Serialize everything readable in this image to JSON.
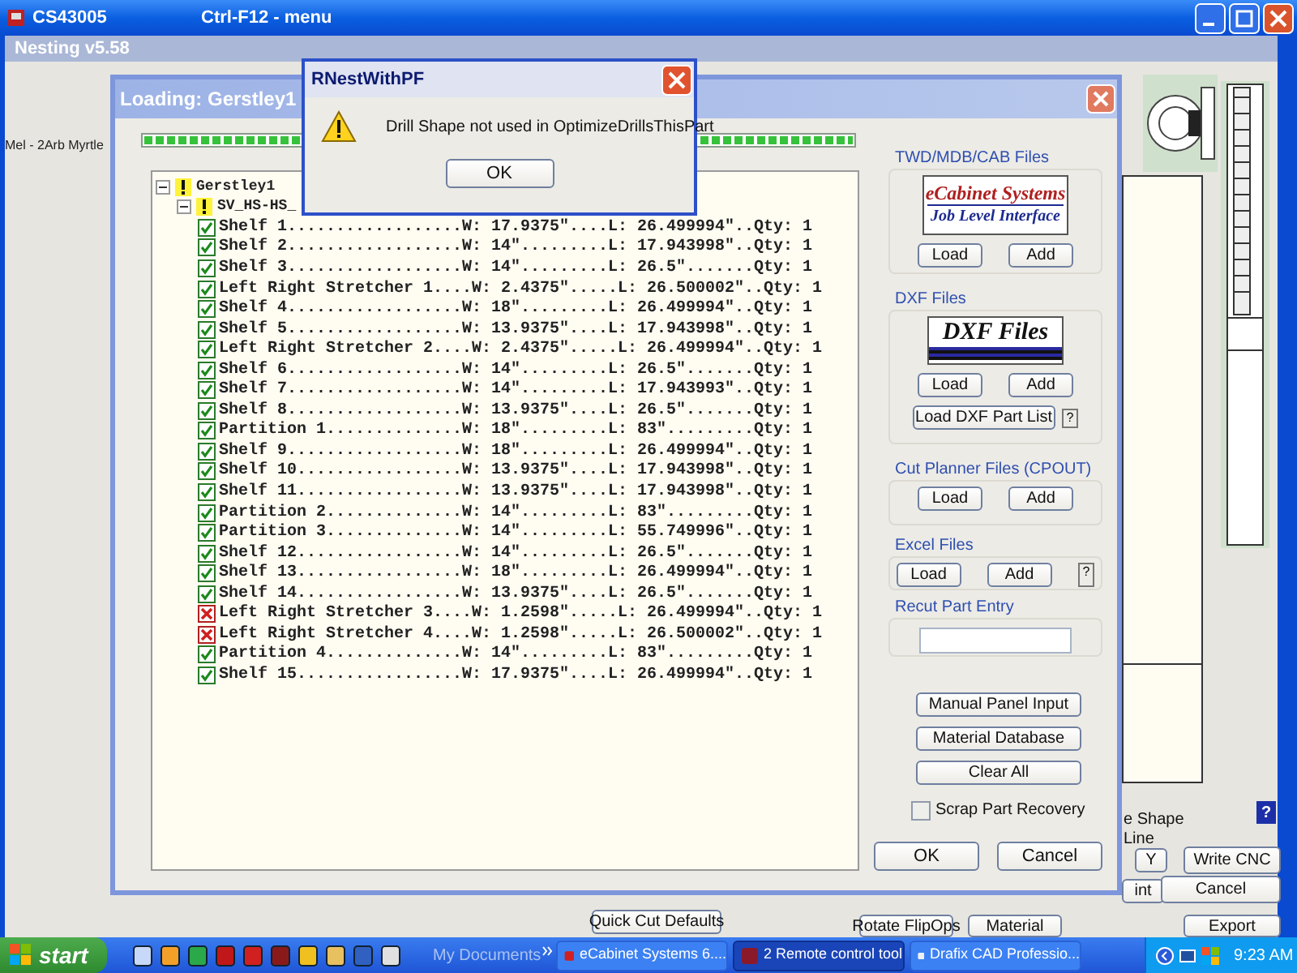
{
  "window": {
    "title": "CS43005",
    "menu_hint": "Ctrl-F12 - menu"
  },
  "app": {
    "title": "Nesting v5.58",
    "material_label": "Mel - 2Arb Myrtle",
    "side_labels": [
      "e Shape",
      "Line"
    ],
    "help": "?",
    "buttons": [
      {
        "label": "Y"
      },
      {
        "label": "Write CNC"
      },
      {
        "label": "int"
      },
      {
        "label": "Cancel"
      },
      {
        "label": "Quick Cut Defaults"
      },
      {
        "label": "Rotate FlipOps"
      },
      {
        "label": "Material"
      },
      {
        "label": "Export"
      }
    ]
  },
  "loading_dialog": {
    "title": "Loading: Gerstley1",
    "progress": {
      "level": 1
    },
    "tree": {
      "kind": "job",
      "label": "Gerstley1",
      "expanded": true,
      "children": [
        {
          "kind": "job",
          "label": "SV_HS-HS_",
          "expanded": true,
          "children": [
            {
              "kind": "part",
              "label": "Shelf 1..................W: 17.9375\"....L: 26.499994\"..Qty: 1",
              "checked": true
            },
            {
              "kind": "part",
              "label": "Shelf 2..................W: 14\".........L: 17.943998\"..Qty: 1",
              "checked": true
            },
            {
              "kind": "part",
              "label": "Shelf 3..................W: 14\".........L: 26.5\".......Qty: 1",
              "checked": true
            },
            {
              "kind": "part",
              "label": "Left Right Stretcher 1....W: 2.4375\".....L: 26.500002\"..Qty: 1",
              "checked": true
            },
            {
              "kind": "part",
              "label": "Shelf 4..................W: 18\".........L: 26.499994\"..Qty: 1",
              "checked": true
            },
            {
              "kind": "part",
              "label": "Shelf 5..................W: 13.9375\"....L: 17.943998\"..Qty: 1",
              "checked": true
            },
            {
              "kind": "part",
              "label": "Left Right Stretcher 2....W: 2.4375\".....L: 26.499994\"..Qty: 1",
              "checked": true
            },
            {
              "kind": "part",
              "label": "Shelf 6..................W: 14\".........L: 26.5\".......Qty: 1",
              "checked": true
            },
            {
              "kind": "part",
              "label": "Shelf 7..................W: 14\".........L: 17.943993\"..Qty: 1",
              "checked": true
            },
            {
              "kind": "part",
              "label": "Shelf 8..................W: 13.9375\"....L: 26.5\".......Qty: 1",
              "checked": true
            },
            {
              "kind": "part",
              "label": "Partition 1..............W: 18\".........L: 83\".........Qty: 1",
              "checked": true
            },
            {
              "kind": "part",
              "label": "Shelf 9..................W: 18\".........L: 26.499994\"..Qty: 1",
              "checked": true
            },
            {
              "kind": "part",
              "label": "Shelf 10.................W: 13.9375\"....L: 17.943998\"..Qty: 1",
              "checked": true
            },
            {
              "kind": "part",
              "label": "Shelf 11.................W: 13.9375\"....L: 17.943998\"..Qty: 1",
              "checked": true
            },
            {
              "kind": "part",
              "label": "Partition 2..............W: 14\".........L: 83\".........Qty: 1",
              "checked": true
            },
            {
              "kind": "part",
              "label": "Partition 3..............W: 14\".........L: 55.749996\"..Qty: 1",
              "checked": true
            },
            {
              "kind": "part",
              "label": "Shelf 12.................W: 14\".........L: 26.5\".......Qty: 1",
              "checked": true
            },
            {
              "kind": "part",
              "label": "Shelf 13.................W: 18\".........L: 26.499994\"..Qty: 1",
              "checked": true
            },
            {
              "kind": "part",
              "label": "Shelf 14.................W: 13.9375\"....L: 26.5\".......Qty: 1",
              "checked": true
            },
            {
              "kind": "part",
              "label": "Left Right Stretcher 3....W: 1.2598\".....L: 26.499994\"..Qty: 1",
              "checked": false
            },
            {
              "kind": "part",
              "label": "Left Right Stretcher 4....W: 1.2598\".....L: 26.500002\"..Qty: 1",
              "checked": false
            },
            {
              "kind": "part",
              "label": "Partition 4..............W: 14\".........L: 83\".........Qty: 1",
              "checked": true
            },
            {
              "kind": "part",
              "label": "Shelf 15.................W: 17.9375\"....L: 26.499994\"..Qty: 1",
              "checked": true
            }
          ]
        }
      ]
    },
    "groups": [
      {
        "kind": "files",
        "title": "TWD/MDB/CAB Files",
        "logo": {
          "kind": "ecabinet",
          "lines": [
            "eCabinet Systems",
            "Job Level Interface"
          ]
        },
        "buttons": [
          "Load",
          "Add"
        ]
      },
      {
        "kind": "files",
        "title": "DXF Files",
        "logo": {
          "kind": "dxf",
          "lines": [
            "DXF Files"
          ]
        },
        "buttons": [
          "Load",
          "Add"
        ],
        "extra_button": "Load DXF Part List",
        "help": "?"
      },
      {
        "kind": "files",
        "title": "Cut Planner Files (CPOUT)",
        "buttons": [
          "Load",
          "Add"
        ]
      },
      {
        "kind": "files",
        "title": "Excel Files",
        "buttons": [
          "Load",
          "Add"
        ],
        "help": "?"
      },
      {
        "kind": "entry",
        "title": "Recut Part Entry"
      }
    ],
    "buttons": [
      "Manual Panel Input",
      "Material Database",
      "Clear All"
    ],
    "scrap_part_recovery": {
      "label": "Scrap Part Recovery",
      "checked": false
    },
    "ok": "OK",
    "cancel": "Cancel"
  },
  "message_box": {
    "title": "RNestWithPF",
    "message": "Drill Shape not used in OptimizeDrillsThisPart",
    "button": "OK"
  },
  "taskbar": {
    "start": "start",
    "toolbar": "My Documents",
    "tasks": [
      {
        "label": "eCabinet Systems 6....",
        "selected": false
      },
      {
        "label": "2 Remote control tool",
        "selected": true
      },
      {
        "label": "Drafix CAD Professio...",
        "selected": false
      }
    ],
    "clock": "9:23 AM"
  }
}
